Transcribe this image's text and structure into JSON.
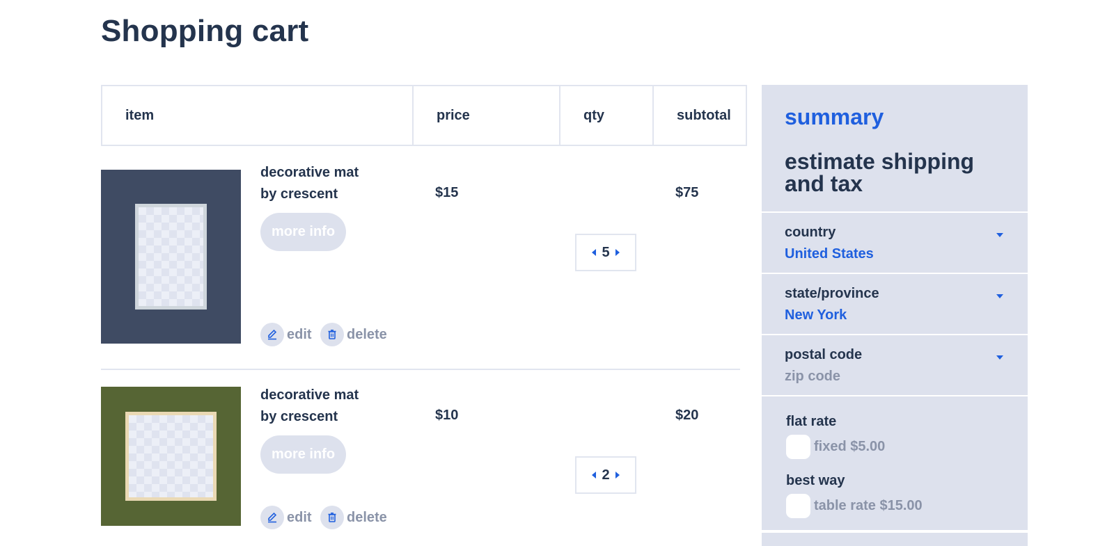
{
  "page": {
    "title": "Shopping cart"
  },
  "cart": {
    "headers": {
      "item": "item",
      "price": "price",
      "qty": "qty",
      "subtotal": "subtotal"
    },
    "items": [
      {
        "name_line1": "decorative mat",
        "name_line2": "by crescent",
        "more_info": "more info",
        "edit": "edit",
        "delete": "delete",
        "price": "$15",
        "qty": "5",
        "subtotal": "$75",
        "mat_color": "#3f4b63",
        "frame_color": "#cfd6dc"
      },
      {
        "name_line1": "decorative mat",
        "name_line2": "by crescent",
        "more_info": "more info",
        "edit": "edit",
        "delete": "delete",
        "price": "$10",
        "qty": "2",
        "subtotal": "$20",
        "mat_color": "#566534",
        "frame_color": "#ead9b4"
      }
    ]
  },
  "summary": {
    "title": "summary",
    "shipping_title": "estimate shipping and tax",
    "country": {
      "label": "country",
      "value": "United States"
    },
    "state": {
      "label": "state/province",
      "value": "New York"
    },
    "postal": {
      "label": "postal code",
      "placeholder": "zip code"
    },
    "rates": [
      {
        "label": "flat rate",
        "option": "fixed $5.00"
      },
      {
        "label": "best way",
        "option": "table rate $15.00"
      }
    ]
  },
  "colors": {
    "accent": "#1f5fde",
    "text": "#24344d",
    "muted": "#8a93a8",
    "panel": "#dde1ed",
    "border": "#e1e5ef"
  },
  "icons": {
    "edit": "pencil-icon",
    "delete": "trash-icon",
    "qty_prev": "chevron-left-icon",
    "qty_next": "chevron-right-icon",
    "dropdown": "caret-down-icon"
  }
}
